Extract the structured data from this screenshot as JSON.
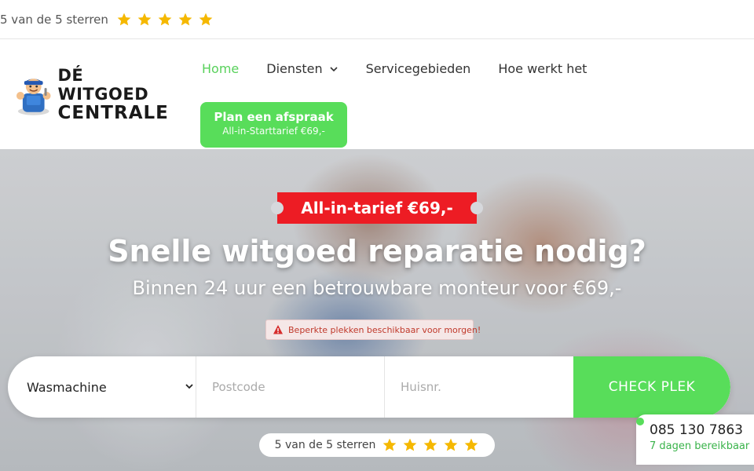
{
  "topbar": {
    "rating_text": "5 van de 5 sterren",
    "stars": 5
  },
  "logo": {
    "line1": "DÉ WITGOED",
    "line2": "CENTRALE"
  },
  "nav": {
    "items": [
      {
        "label": "Home",
        "active": true
      },
      {
        "label": "Diensten",
        "has_dropdown": true
      },
      {
        "label": "Servicegebieden"
      },
      {
        "label": "Hoe werkt het"
      }
    ]
  },
  "cta": {
    "title": "Plan een afspraak",
    "subtitle": "All-in-Starttarief €69,-"
  },
  "hero": {
    "ribbon": "All-in-tarief €69,-",
    "title": "Snelle witgoed reparatie nodig?",
    "subtitle": "Binnen 24 uur een betrouwbare monteur voor €69,-",
    "warning": "Beperkte plekken beschikbaar voor morgen!"
  },
  "search": {
    "appliance_value": "Wasmachine",
    "postcode_placeholder": "Postcode",
    "huisnr_placeholder": "Huisnr.",
    "button_label": "CHECK PLEK"
  },
  "bottom_rating": {
    "rating_text": "5 van de 5 sterren",
    "stars": 5
  },
  "contact": {
    "phone": "085 130 7863",
    "availability": "7 dagen bereikbaar"
  },
  "colors": {
    "accent_green": "#58dd5a",
    "active_nav": "#58d15b",
    "ribbon_red": "#ed1c24",
    "star_yellow": "#f5b800"
  }
}
